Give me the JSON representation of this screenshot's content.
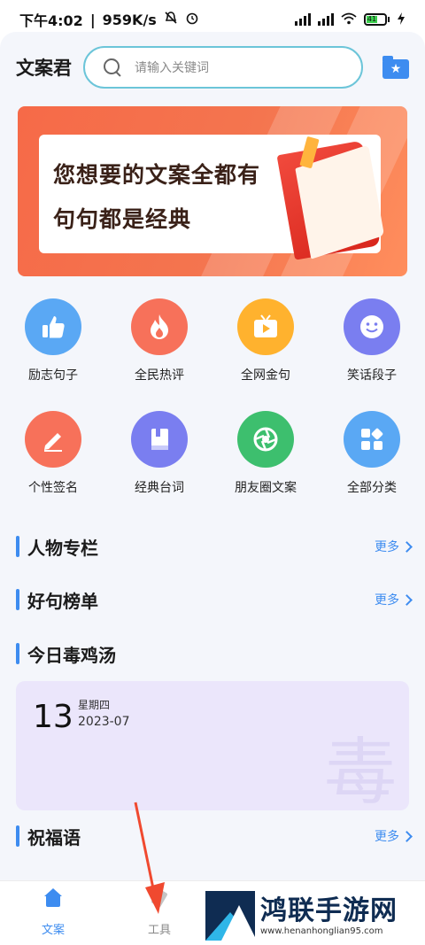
{
  "status_bar": {
    "time": "下午4:02",
    "speed": "959K/s",
    "battery": "41"
  },
  "header": {
    "app_title": "文案君",
    "search_placeholder": "请输入关键词"
  },
  "banner": {
    "line1": "您想要的文案全都有",
    "line2": "句句都是经典"
  },
  "categories": [
    {
      "label": "励志句子",
      "icon": "thumbs-up-icon",
      "color": "#5aa8f4"
    },
    {
      "label": "全民热评",
      "icon": "flame-icon",
      "color": "#f7715a"
    },
    {
      "label": "全网金句",
      "icon": "tv-play-icon",
      "color": "#ffb22e"
    },
    {
      "label": "笑话段子",
      "icon": "smile-icon",
      "color": "#7a7ef0"
    },
    {
      "label": "个性签名",
      "icon": "pencil-icon",
      "color": "#f7715a"
    },
    {
      "label": "经典台词",
      "icon": "book-icon",
      "color": "#7a7ef0"
    },
    {
      "label": "朋友圈文案",
      "icon": "aperture-icon",
      "color": "#3dbf6e"
    },
    {
      "label": "全部分类",
      "icon": "grid-icon",
      "color": "#5aa8f4"
    }
  ],
  "sections": {
    "people": {
      "title": "人物专栏",
      "more": "更多"
    },
    "ranking": {
      "title": "好句榜单",
      "more": "更多"
    },
    "daily": {
      "title": "今日毒鸡汤"
    },
    "blessing": {
      "title": "祝福语",
      "more": "更多"
    }
  },
  "daily_card": {
    "day": "13",
    "weekday": "星期四",
    "year_month": "2023-07",
    "watermark": "毒"
  },
  "bottom_nav": [
    {
      "label": "文案",
      "active": true,
      "color": "#3d8cf0"
    },
    {
      "label": "工具",
      "active": false,
      "color": "#888888"
    }
  ],
  "watermark_logo": {
    "name": "鸿联手游网",
    "url": "www.henanhonglian95.com"
  }
}
